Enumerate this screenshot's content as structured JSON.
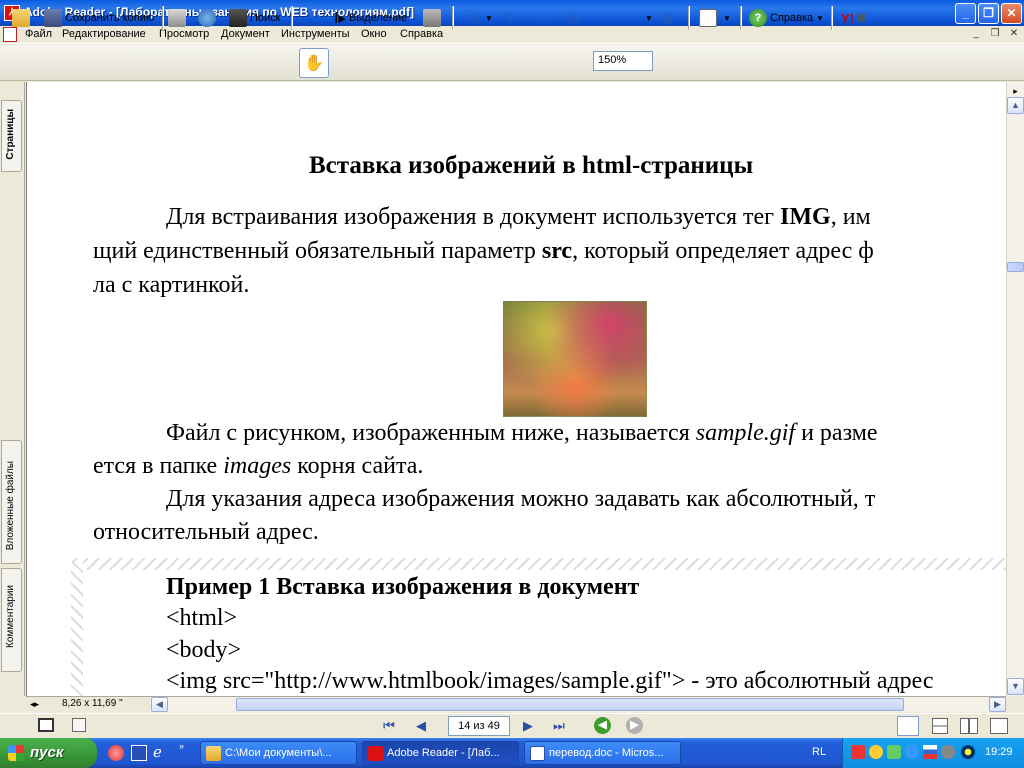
{
  "window": {
    "title": "Adobe Reader - [Лабораторные занятия по WEB технологиям.pdf]",
    "app_icon": "adobe-reader-icon"
  },
  "menu": [
    "Файл",
    "Редактирование",
    "Просмотр",
    "Документ",
    "Инструменты",
    "Окно",
    "Справка"
  ],
  "toolbar": {
    "save_copy": "Сохранить копию",
    "search": "Поиск",
    "select": "Выделение",
    "zoom": "150%",
    "help": "Справка",
    "yahoo": "Y!"
  },
  "nav_tabs": {
    "pages": "Страницы",
    "attachments": "Вложенные файлы",
    "comments": "Комментарии"
  },
  "document": {
    "heading": "Вставка изображений в html-страницы",
    "p1_l1_a": "Для встраивания изображения в документ используется тег ",
    "p1_l1_b": "IMG",
    "p1_l1_c": ", им",
    "p1_l2_a": "щий единственный обязательный параметр ",
    "p1_l2_b": "src",
    "p1_l2_c": ", который определяет адрес ф",
    "p1_l3": "ла с картинкой.",
    "p2_l1_a": "Файл с рисунком, изображенным ниже, называется ",
    "p2_l1_b": "sample.gif",
    "p2_l1_c": " и разме",
    "p2_l2_a": "ется в папке ",
    "p2_l2_b": "images",
    "p2_l2_c": " корня сайта.",
    "p3_l1": "Для указания адреса изображения можно задавать как абсолютный, т",
    "p3_l2": "относительный адрес.",
    "example_title": "Пример 1 Вставка изображения в документ",
    "code": [
      "<html>",
      "<body>",
      "<img src=\"http://www.htmlbook/images/sample.gif\"> - это абсолютный адрес"
    ]
  },
  "status": {
    "page_size": "8,26 x 11,69 \"",
    "page": "14 из 49"
  },
  "taskbar": {
    "start": "пуск",
    "tasks": [
      "C:\\Мои документы\\...",
      "Adobe Reader - [Лаб...",
      "перевод.doc - Micros..."
    ],
    "lang": "RL",
    "clock": "19:29"
  }
}
